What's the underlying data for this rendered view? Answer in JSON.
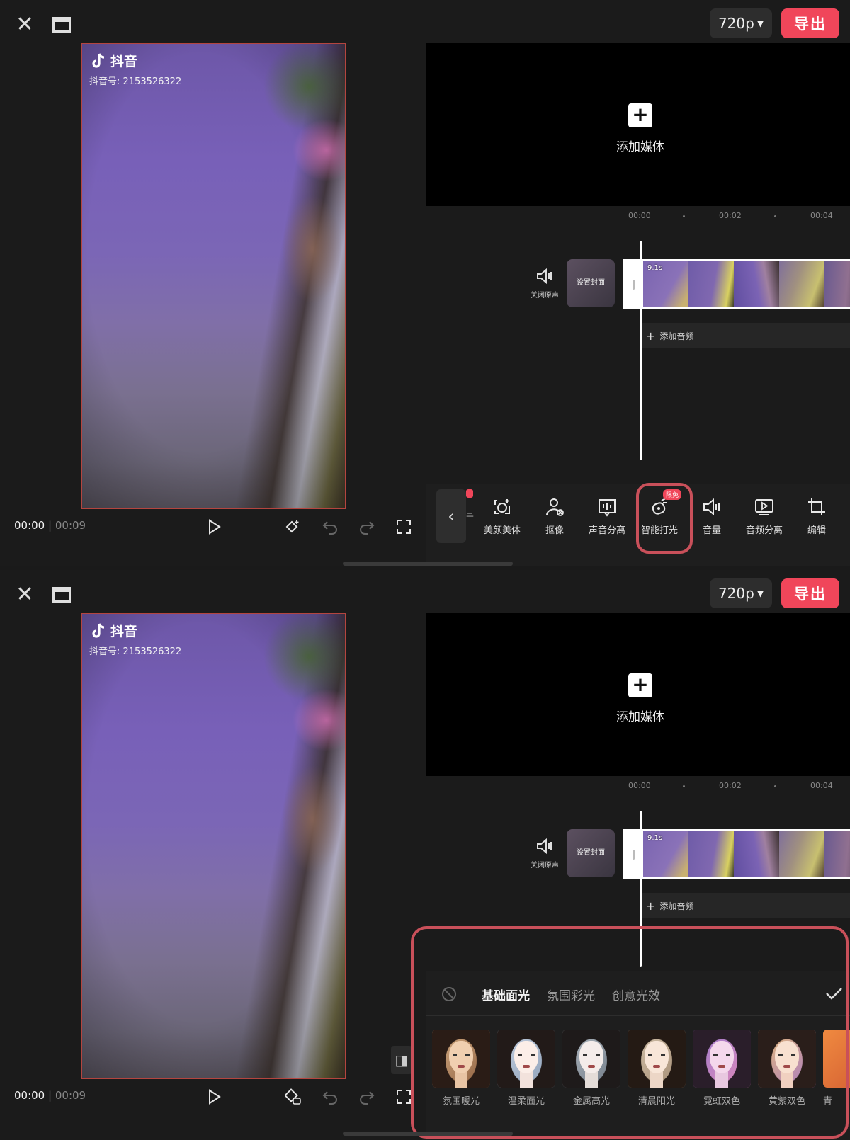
{
  "topbar": {
    "resolution": "720p",
    "export_label": "导出"
  },
  "video": {
    "brand": "抖音",
    "account_id": "抖音号: 2153526322"
  },
  "playback": {
    "current": "00:00",
    "separator": "|",
    "total": "00:09"
  },
  "media": {
    "add_label": "添加媒体"
  },
  "timeline": {
    "ruler": [
      "00:00",
      "00:02",
      "00:04"
    ],
    "mute_label": "关闭原声",
    "cover_label": "设置封面",
    "clip_duration": "9.1s",
    "add_audio_label": "添加音频"
  },
  "toolbar": {
    "partial_label": "三",
    "items": [
      {
        "label": "美颜美体",
        "icon": "face-beauty-icon"
      },
      {
        "label": "抠像",
        "icon": "cutout-person-icon"
      },
      {
        "label": "声音分离",
        "icon": "voice-separate-icon"
      },
      {
        "label": "智能打光",
        "icon": "smart-light-icon",
        "badge": "限免"
      },
      {
        "label": "音量",
        "icon": "volume-icon"
      },
      {
        "label": "音频分离",
        "icon": "audio-separate-icon"
      },
      {
        "label": "编辑",
        "icon": "crop-edit-icon"
      }
    ]
  },
  "light_panel": {
    "tabs": [
      "基础面光",
      "氛围彩光",
      "创意光效"
    ],
    "active_tab": 0,
    "presets": [
      {
        "label": "氛围暖光"
      },
      {
        "label": "温柔面光"
      },
      {
        "label": "金属高光"
      },
      {
        "label": "清晨阳光"
      },
      {
        "label": "霓虹双色"
      },
      {
        "label": "黄紫双色"
      },
      {
        "label": "青"
      }
    ]
  },
  "colors": {
    "accent": "#f0465a",
    "highlight": "#c9505a",
    "background": "#1b1b1b"
  }
}
